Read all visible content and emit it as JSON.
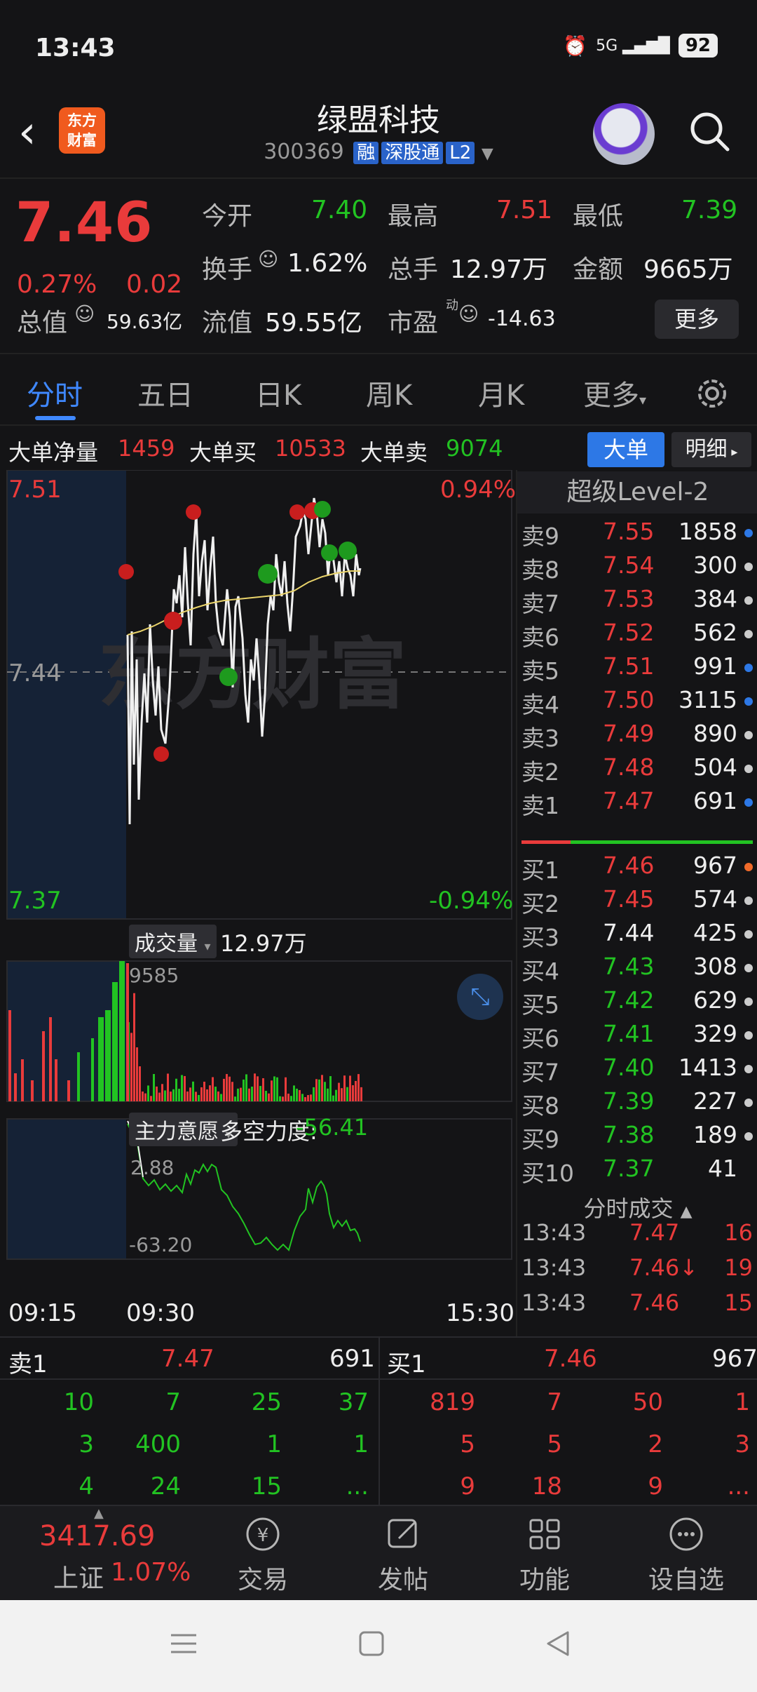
{
  "status": {
    "time": "13:43",
    "network": "5G",
    "battery": "92"
  },
  "header": {
    "app_logo": "东方\n财富",
    "stock_name": "绿盟科技",
    "code": "300369",
    "tags": [
      "融",
      "深股通",
      "L2"
    ]
  },
  "quote": {
    "price": "7.46",
    "change_pct": "0.27%",
    "change": "0.02",
    "open_label": "今开",
    "open": "7.40",
    "high_label": "最高",
    "high": "7.51",
    "low_label": "最低",
    "low": "7.39",
    "turnover_label": "换手",
    "turnover": "1.62%",
    "volume_label": "总手",
    "volume": "12.97万",
    "amount_label": "金额",
    "amount": "9665万",
    "mktcap_label": "总值",
    "mktcap": "59.63亿",
    "float_label": "流值",
    "float": "59.55亿",
    "pe_label": "市盈",
    "pe_sup": "动",
    "pe": "-14.63",
    "more_button": "更多"
  },
  "tabs": [
    "分时",
    "五日",
    "日K",
    "周K",
    "月K",
    "更多"
  ],
  "bigorder": {
    "net_label": "大单净量",
    "net": "1459",
    "buy_label": "大单买",
    "buy": "10533",
    "sell_label": "大单卖",
    "sell": "9074",
    "btn_big": "大单",
    "btn_detail": "明细"
  },
  "chart": {
    "price_top": "7.51",
    "pct_top": "0.94%",
    "price_mid": "7.44",
    "price_bottom": "7.37",
    "pct_bottom": "-0.94%",
    "watermark": "东方财富",
    "volume_label": "成交量",
    "volume_total": "12.97万",
    "volume_max": "9585",
    "ind_label": "主力意愿",
    "ind_name": "多空力度:",
    "ind_value": "-56.41",
    "ind_top": "2.88",
    "ind_bottom": "-63.20",
    "time_start": "09:15",
    "time_open": "09:30",
    "time_end": "15:30"
  },
  "book": {
    "title": "超级Level-2",
    "sells": [
      {
        "label": "卖9",
        "price": "7.55",
        "vol": "1858",
        "dot": "#2d78e6"
      },
      {
        "label": "卖8",
        "price": "7.54",
        "vol": "300",
        "dot": "#cccccc"
      },
      {
        "label": "卖7",
        "price": "7.53",
        "vol": "384",
        "dot": "#cccccc"
      },
      {
        "label": "卖6",
        "price": "7.52",
        "vol": "562",
        "dot": "#cccccc"
      },
      {
        "label": "卖5",
        "price": "7.51",
        "vol": "991",
        "dot": "#2d78e6"
      },
      {
        "label": "卖4",
        "price": "7.50",
        "vol": "3115",
        "dot": "#2d78e6"
      },
      {
        "label": "卖3",
        "price": "7.49",
        "vol": "890",
        "dot": "#cccccc"
      },
      {
        "label": "卖2",
        "price": "7.48",
        "vol": "504",
        "dot": "#cccccc"
      },
      {
        "label": "卖1",
        "price": "7.47",
        "vol": "691",
        "dot": "#2d78e6"
      }
    ],
    "buys": [
      {
        "label": "买1",
        "price": "7.46",
        "vol": "967",
        "dot": "#f06a2a"
      },
      {
        "label": "买2",
        "price": "7.45",
        "vol": "574",
        "dot": "#cccccc"
      },
      {
        "label": "买3",
        "price": "7.44",
        "vol": "425",
        "dot": "#cccccc"
      },
      {
        "label": "买4",
        "price": "7.43",
        "vol": "308",
        "dot": "#cccccc"
      },
      {
        "label": "买5",
        "price": "7.42",
        "vol": "629",
        "dot": "#cccccc"
      },
      {
        "label": "买6",
        "price": "7.41",
        "vol": "329",
        "dot": "#cccccc"
      },
      {
        "label": "买7",
        "price": "7.40",
        "vol": "1413",
        "dot": "#cccccc"
      },
      {
        "label": "买8",
        "price": "7.39",
        "vol": "227",
        "dot": "#cccccc"
      },
      {
        "label": "买9",
        "price": "7.38",
        "vol": "189",
        "dot": "#cccccc"
      },
      {
        "label": "买10",
        "price": "7.37",
        "vol": "41",
        "dot": ""
      }
    ],
    "trades_title": "分时成交",
    "trades": [
      {
        "time": "13:43",
        "price": "7.47",
        "vol": "16"
      },
      {
        "time": "13:43",
        "price": "7.46↓",
        "vol": "19"
      },
      {
        "time": "13:43",
        "price": "7.46",
        "vol": "15"
      }
    ]
  },
  "queue": {
    "sell_label": "卖1",
    "sell_price": "7.47",
    "sell_vol": "691",
    "buy_label": "买1",
    "buy_price": "7.46",
    "buy_vol": "967",
    "sell_rows": [
      [
        "10",
        "7",
        "25",
        "37"
      ],
      [
        "3",
        "400",
        "1",
        "1"
      ],
      [
        "4",
        "24",
        "15",
        "..."
      ]
    ],
    "buy_rows": [
      [
        "819",
        "7",
        "50",
        "1"
      ],
      [
        "5",
        "5",
        "2",
        "3"
      ],
      [
        "9",
        "18",
        "9",
        "..."
      ]
    ]
  },
  "nav": {
    "index_value": "3417.69",
    "index_name": "上证",
    "index_pct": "1.07%",
    "items": [
      "交易",
      "发帖",
      "功能",
      "设自选"
    ]
  },
  "colors": {
    "up": "#e93b3b",
    "down": "#22c322",
    "accent": "#2d78e6",
    "bg": "#141416"
  }
}
